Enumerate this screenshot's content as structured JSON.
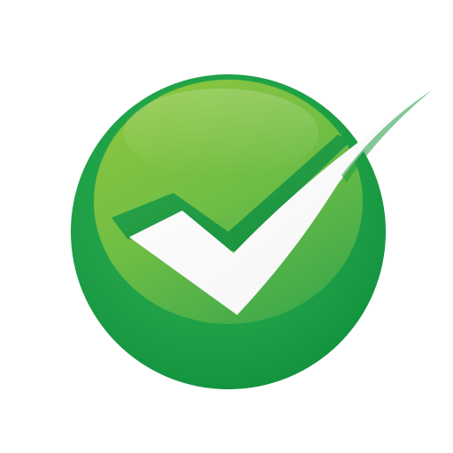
{
  "icon": {
    "name": "checkmark-icon",
    "colors": {
      "background": "#ffffff",
      "outer_dark": "#0c8f3a",
      "outer_mid": "#1fa047",
      "inner_light": "#8cc63f",
      "inner_mid": "#5cb947",
      "inner_dark": "#2aa14a",
      "check_face": "#ffffff",
      "check_side": "#26a149"
    }
  }
}
